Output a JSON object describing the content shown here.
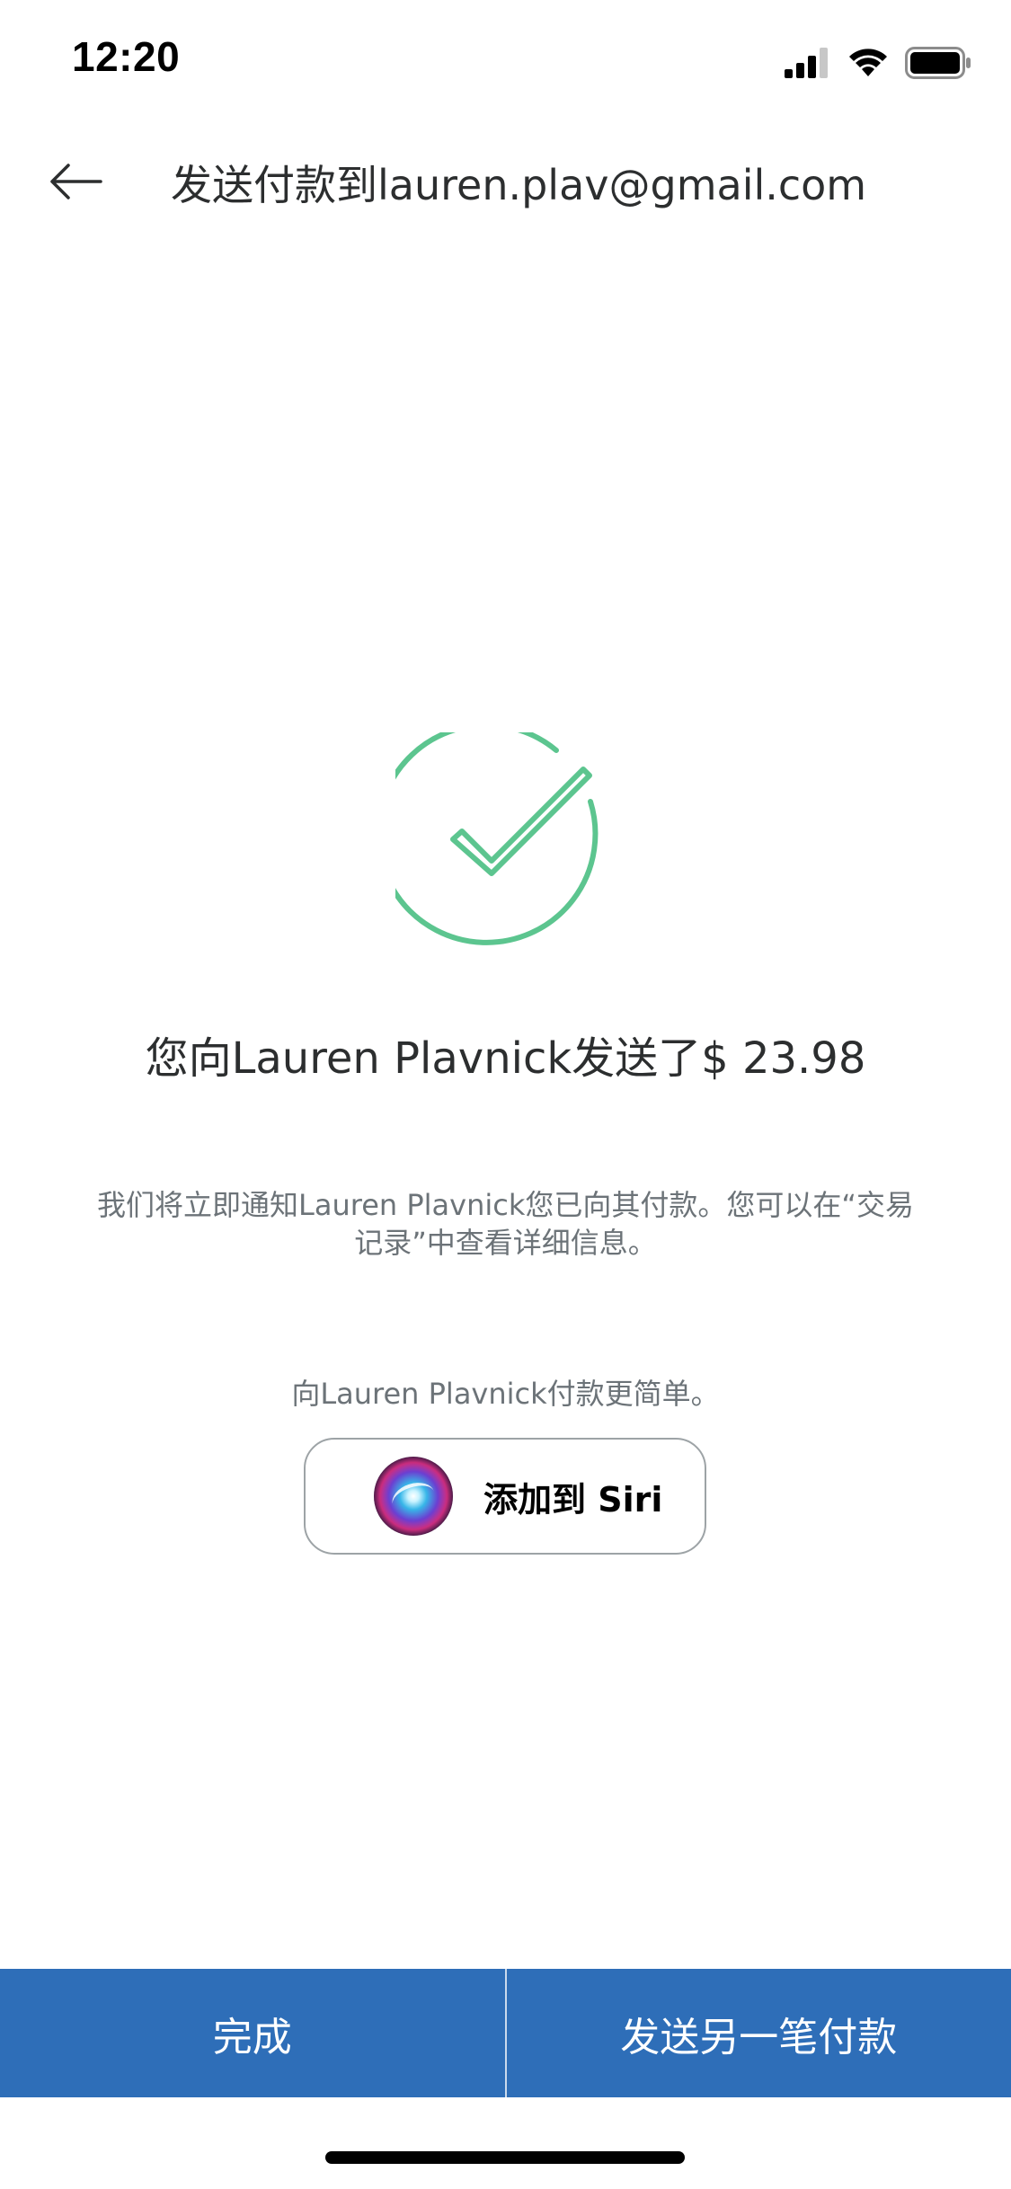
{
  "status_bar": {
    "time": "12:20",
    "icons": [
      "signal-icon",
      "wifi-icon",
      "battery-icon"
    ]
  },
  "header": {
    "back_icon": "arrow-left-icon",
    "title": "发送付款到lauren.plav@gmail.com"
  },
  "success": {
    "icon": "checkmark-circle-icon",
    "color": "#5cc58f",
    "headline": "您向Lauren Plavnick发送了$ 23.98",
    "notice": "我们将立即通知Lauren Plavnick您已向其付款。您可以在“交易记录”中查看详细信息。"
  },
  "siri": {
    "prompt": "向Lauren Plavnick付款更简单。",
    "button_label": "添加到 Siri",
    "icon": "siri-icon"
  },
  "actions": {
    "done_label": "完成",
    "send_another_label": "发送另一笔付款",
    "bar_color": "#2e6eb8"
  }
}
